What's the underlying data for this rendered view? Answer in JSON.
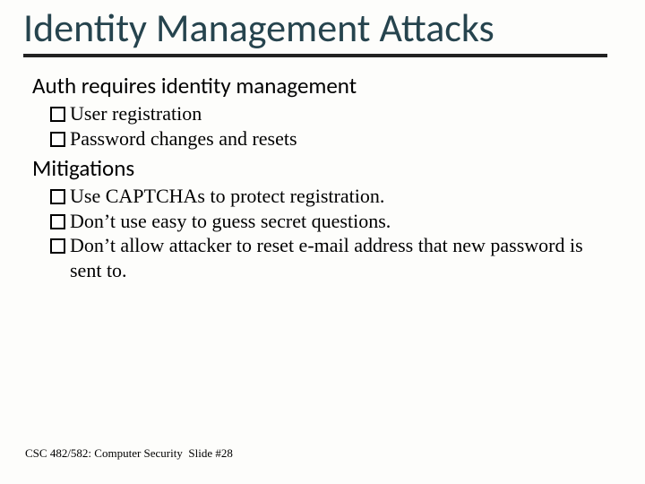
{
  "title": "Identity Management Attacks",
  "section1": {
    "heading": "Auth requires identity management",
    "items": [
      "User registration",
      "Password changes and resets"
    ]
  },
  "section2": {
    "heading": "Mitigations",
    "items": [
      "Use CAPTCHAs to protect registration.",
      "Don’t use easy to guess secret questions.",
      "Don’t allow attacker to reset e-mail address that new password is sent to."
    ]
  },
  "footer": {
    "course": "CSC 482/582: Computer Security",
    "slide_label": "Slide #28"
  }
}
